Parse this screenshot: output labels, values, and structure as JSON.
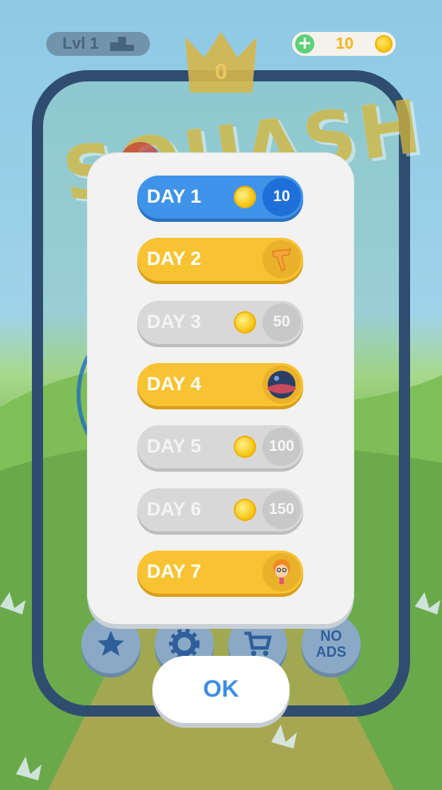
{
  "hud": {
    "level_label": "Lvl 1",
    "crown_count": "0",
    "coins": "10"
  },
  "background": {
    "logo_text": "SQUASH",
    "no_ads_label": "NO\nADS"
  },
  "daily_rewards": [
    {
      "label": "DAY 1",
      "reward_type": "coin",
      "amount": "10",
      "state": "current",
      "color": "#3f93e8"
    },
    {
      "label": "DAY 2",
      "reward_type": "item",
      "icon": "racket-icon",
      "state": "special",
      "color": "#f8c332"
    },
    {
      "label": "DAY 3",
      "reward_type": "coin",
      "amount": "50",
      "state": "locked",
      "color": "#d8d8d8"
    },
    {
      "label": "DAY 4",
      "reward_type": "item",
      "icon": "ball-skin-icon",
      "state": "special",
      "color": "#f8c332"
    },
    {
      "label": "DAY 5",
      "reward_type": "coin",
      "amount": "100",
      "state": "locked",
      "color": "#d8d8d8"
    },
    {
      "label": "DAY 6",
      "reward_type": "coin",
      "amount": "150",
      "state": "locked",
      "color": "#d8d8d8"
    },
    {
      "label": "DAY 7",
      "reward_type": "item",
      "icon": "character-icon",
      "state": "special",
      "color": "#f8c332"
    }
  ],
  "ok_button": {
    "label": "OK"
  }
}
